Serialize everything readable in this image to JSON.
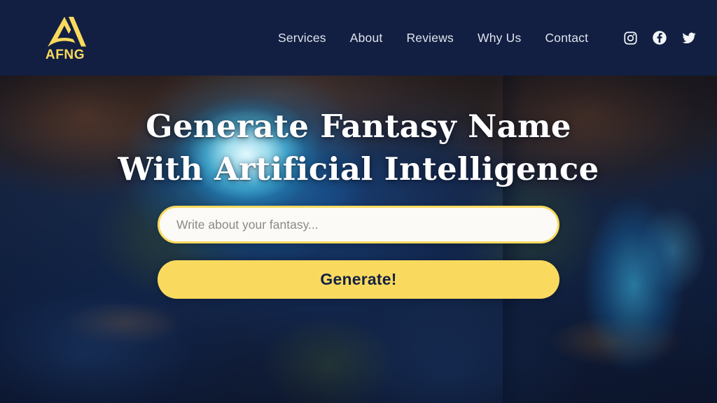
{
  "brand": {
    "logo_icon": "afng-triangle-logo-icon",
    "wordmark": "AFNG",
    "color": "#fada5e"
  },
  "header": {
    "background_color": "#121f42",
    "nav_items": [
      {
        "label": "Services",
        "name": "services"
      },
      {
        "label": "About",
        "name": "about"
      },
      {
        "label": "Reviews",
        "name": "reviews"
      },
      {
        "label": "Why Us",
        "name": "why-us"
      },
      {
        "label": "Contact",
        "name": "contact"
      }
    ],
    "socials": [
      {
        "icon": "instagram-icon",
        "label": "Instagram"
      },
      {
        "icon": "facebook-icon",
        "label": "Facebook"
      },
      {
        "icon": "twitter-icon",
        "label": "Twitter"
      }
    ],
    "nav_text_color": "#dfe3ec"
  },
  "hero": {
    "headline_line1": "Generate Fantasy Name",
    "headline_line2": "With Artificial Intelligence",
    "headline_color": "#ffffff",
    "search": {
      "value": "",
      "placeholder": "Write about your fantasy...",
      "border_color": "#fada5e",
      "background_color": "#fbfaf6"
    },
    "generate_button": {
      "label": "Generate!",
      "background_color": "#fada5e",
      "text_color": "#152142"
    },
    "background_description": "fantasy cave with glowing blue pool and wooden bridges"
  }
}
